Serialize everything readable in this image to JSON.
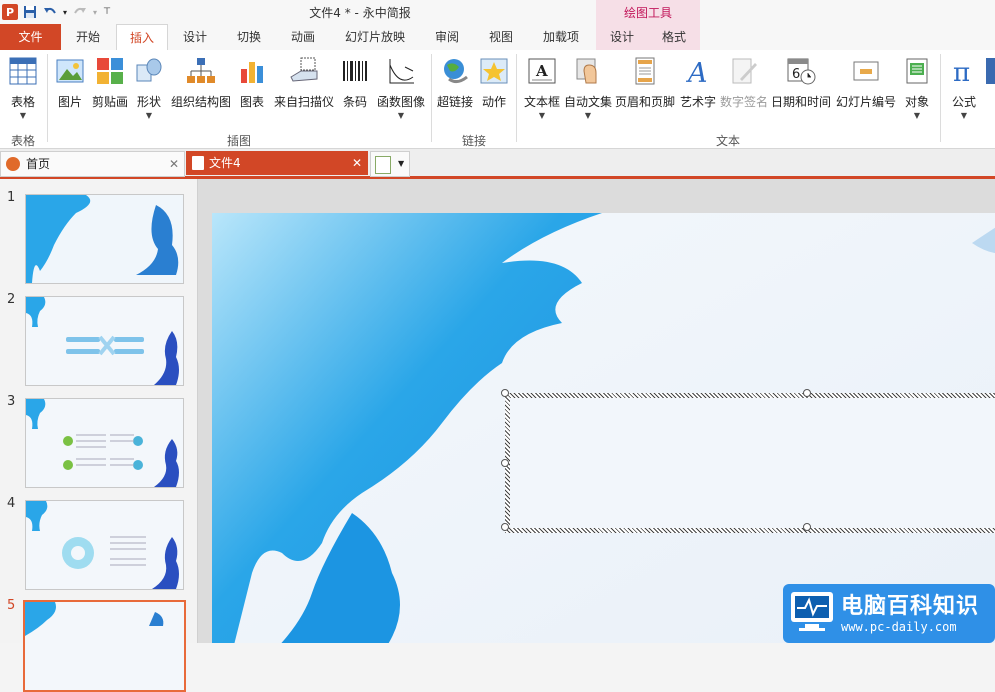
{
  "window": {
    "title": "文件4 * - 永中简报",
    "tool_header": "绘图工具"
  },
  "tabs": [
    {
      "label": "文件",
      "key": "file"
    },
    {
      "label": "开始",
      "key": "home"
    },
    {
      "label": "插入",
      "key": "insert",
      "active": true
    },
    {
      "label": "设计",
      "key": "design"
    },
    {
      "label": "切换",
      "key": "transition"
    },
    {
      "label": "动画",
      "key": "animation"
    },
    {
      "label": "幻灯片放映",
      "key": "slideshow"
    },
    {
      "label": "审阅",
      "key": "review"
    },
    {
      "label": "视图",
      "key": "view"
    },
    {
      "label": "加载项",
      "key": "addins"
    },
    {
      "label": "设计",
      "key": "tool-design"
    },
    {
      "label": "格式",
      "key": "tool-format"
    }
  ],
  "ribbon": {
    "buttons": [
      {
        "label": "表格",
        "icon": "table-icon"
      },
      {
        "label": "图片",
        "icon": "picture-icon"
      },
      {
        "label": "剪贴画",
        "icon": "clipart-icon"
      },
      {
        "label": "形状",
        "icon": "shapes-icon"
      },
      {
        "label": "组织结构图",
        "icon": "org-chart-icon"
      },
      {
        "label": "图表",
        "icon": "chart-icon"
      },
      {
        "label": "来自扫描仪",
        "icon": "scanner-icon"
      },
      {
        "label": "条码",
        "icon": "barcode-icon"
      },
      {
        "label": "函数图像",
        "icon": "function-graph-icon"
      },
      {
        "label": "超链接",
        "icon": "hyperlink-icon"
      },
      {
        "label": "动作",
        "icon": "action-icon"
      },
      {
        "label": "文本框",
        "icon": "textbox-icon"
      },
      {
        "label": "自动文集",
        "icon": "autotext-icon"
      },
      {
        "label": "页眉和页脚",
        "icon": "header-footer-icon"
      },
      {
        "label": "艺术字",
        "icon": "wordart-icon"
      },
      {
        "label": "数字签名",
        "icon": "digital-signature-icon",
        "disabled": true
      },
      {
        "label": "日期和时间",
        "icon": "date-time-icon"
      },
      {
        "label": "幻灯片编号",
        "icon": "slide-number-icon"
      },
      {
        "label": "对象",
        "icon": "object-icon"
      },
      {
        "label": "公式",
        "icon": "formula-icon"
      }
    ],
    "groups": [
      "表格",
      "插图",
      "链接",
      "文本"
    ]
  },
  "doc_tabs": {
    "home": "首页",
    "file": "文件4"
  },
  "slides": [
    {
      "number": "1"
    },
    {
      "number": "2"
    },
    {
      "number": "3"
    },
    {
      "number": "4"
    },
    {
      "number": "5",
      "selected": true
    }
  ],
  "watermark": {
    "title": "电脑百科知识",
    "url": "www.pc-daily.com"
  },
  "colors": {
    "accent": "#d24726",
    "tool_tab": "#f6dfe7",
    "splash_blue": "#2aa6e8"
  }
}
